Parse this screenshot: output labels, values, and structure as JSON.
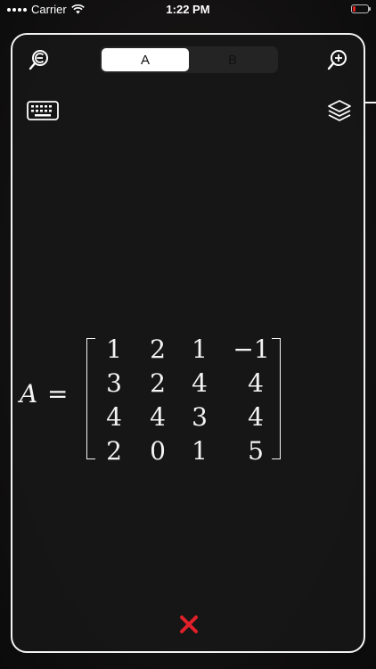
{
  "status_bar": {
    "carrier": "Carrier",
    "time": "1:22 PM"
  },
  "tabs": [
    {
      "label": "A",
      "active": true
    },
    {
      "label": "B",
      "active": false
    }
  ],
  "toolbar": {
    "zoom_out_icon": "zoom-out-icon",
    "zoom_in_icon": "zoom-in-icon",
    "keyboard_icon": "keyboard-icon",
    "layers_icon": "layers-icon"
  },
  "formula": {
    "lhs": "A",
    "equals": "=",
    "matrix": [
      [
        "1",
        "2",
        "1",
        "−1"
      ],
      [
        "3",
        "2",
        "4",
        "4"
      ],
      [
        "4",
        "4",
        "3",
        "4"
      ],
      [
        "2",
        "0",
        "1",
        "5"
      ]
    ]
  },
  "close_icon": "close-icon",
  "colors": {
    "accent_close": "#e0202a",
    "border": "#f2f2f2",
    "segment_bg": "#242424",
    "segment_active": "#ffffff"
  }
}
